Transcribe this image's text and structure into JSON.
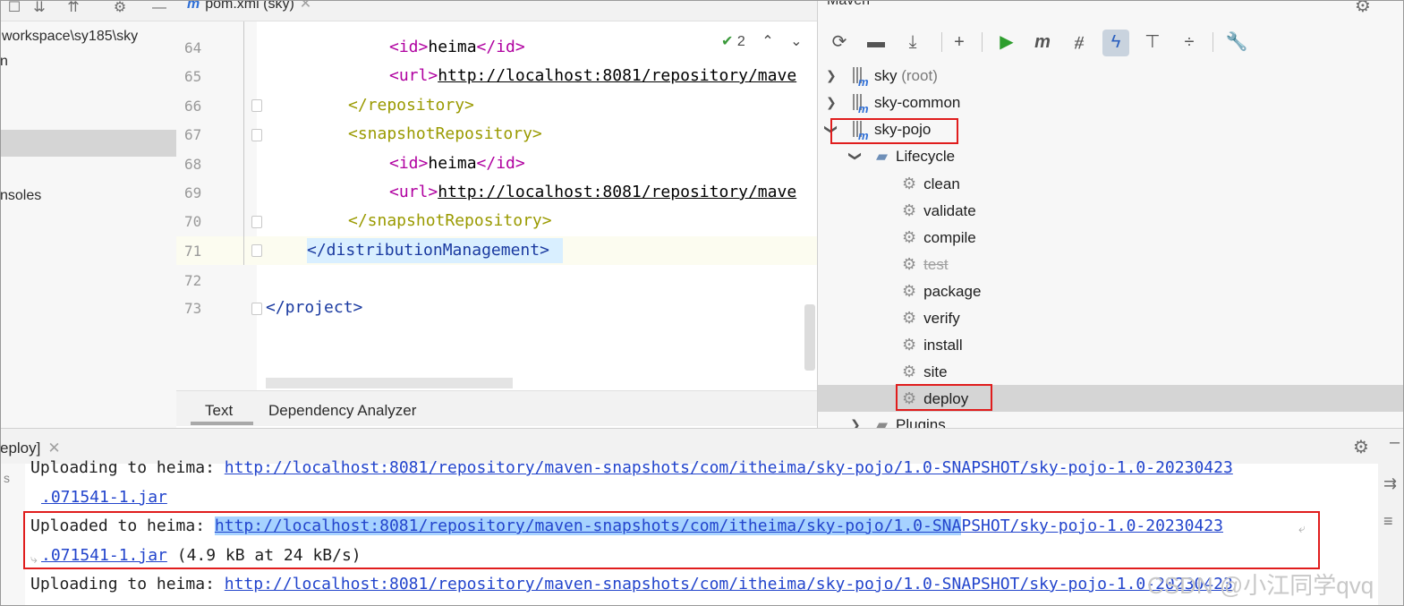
{
  "project": {
    "path_text": "workspace\\sy185\\sky",
    "line2": "n",
    "consoles_label": "nsoles"
  },
  "editor": {
    "tab_label": "pom.xml (sky)",
    "inspection_count": "2",
    "line_numbers": [
      "64",
      "65",
      "66",
      "67",
      "68",
      "69",
      "70",
      "71",
      "72",
      "73"
    ],
    "lines": {
      "l64_open": "<id>",
      "l64_val": "heima",
      "l64_close": "</id>",
      "l65_open": "<url>",
      "l65_val": "http://localhost:8081/repository/mave",
      "l66_tag": "</repository>",
      "l67_tag": "<snapshotRepository>",
      "l68_open": "<id>",
      "l68_val": "heima",
      "l68_close": "</id>",
      "l69_open": "<url>",
      "l69_val": "http://localhost:8081/repository/mave",
      "l70_tag": "</snapshotRepository>",
      "l71_tag": "</distributionManagement>",
      "l73_tag": "</project>"
    },
    "bottom_tabs": [
      "Text",
      "Dependency Analyzer"
    ]
  },
  "maven": {
    "title": "Maven",
    "tree": {
      "sky": "sky",
      "sky_root": "(root)",
      "sky_common": "sky-common",
      "sky_pojo": "sky-pojo",
      "lifecycle": "Lifecycle",
      "goals": [
        "clean",
        "validate",
        "compile",
        "test",
        "package",
        "verify",
        "install",
        "site",
        "deploy"
      ],
      "plugins": "Plugins"
    }
  },
  "console": {
    "tab_label": "eploy]",
    "lines": {
      "l1_prefix": "Uploading to heima: ",
      "l1_link": "http://localhost:8081/repository/maven-snapshots/com/itheima/sky-pojo/1.0-SNAPSHOT/sky-pojo-1.0-20230423",
      "l2_link": ".071541-1.jar",
      "l3_prefix": "Uploaded to heima: ",
      "l3_link_sel": "http://localhost:8081/repository/maven-snapshots/com/itheima/sky-pojo/1.0-SNA",
      "l3_link_rest": "PSHOT/sky-pojo-1.0-20230423",
      "l4_link": ".071541-1.jar",
      "l4_suffix": " (4.9 kB at 24 kB/s)",
      "l5_prefix": "Uploading to heima: ",
      "l5_link": "http://localhost:8081/repository/maven-snapshots/com/itheima/sky-pojo/1.0-SNAPSHOT/sky-pojo-1.0-20230423"
    }
  },
  "watermark": "CSDN @小江同学qvq",
  "colors": {
    "highlight_red": "#e01d1d",
    "link_blue": "#2244cc",
    "selection": "#a6d2ff"
  }
}
